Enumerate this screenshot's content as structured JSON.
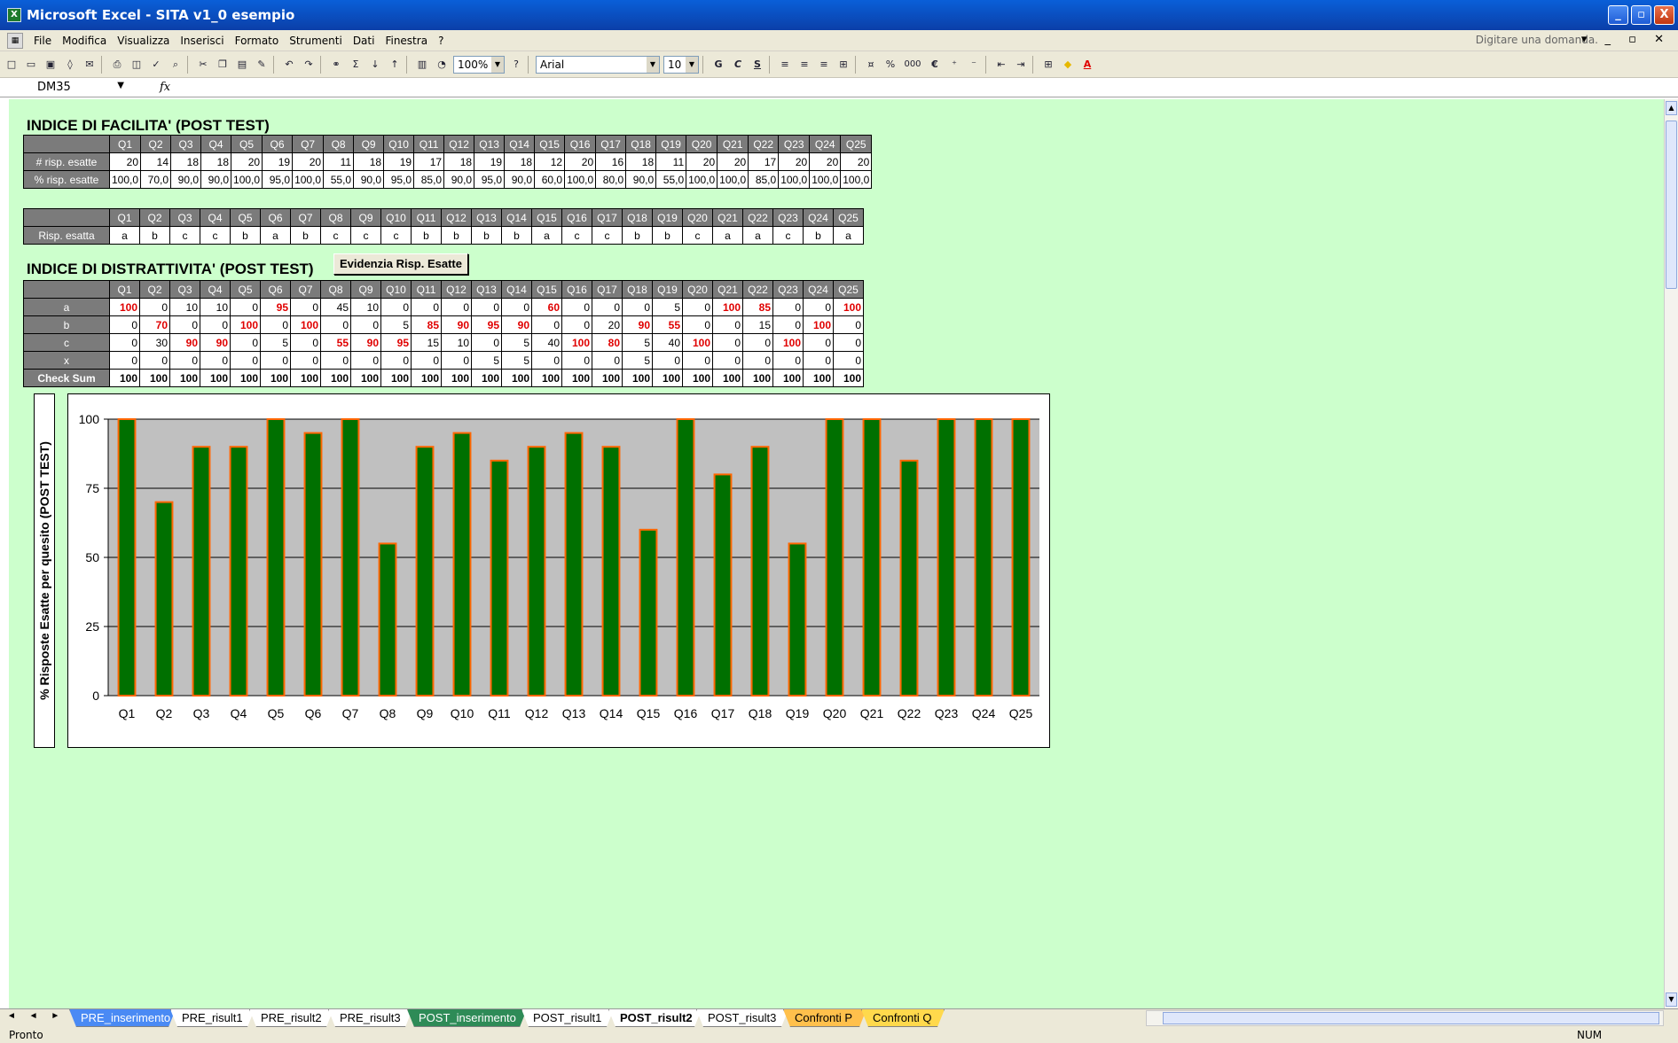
{
  "window": {
    "title": "Microsoft Excel - SITA v1_0 esempio",
    "min": "_",
    "max": "▫",
    "close": "X"
  },
  "menu": {
    "items": [
      "File",
      "Modifica",
      "Visualizza",
      "Inserisci",
      "Formato",
      "Strumenti",
      "Dati",
      "Finestra",
      "?"
    ],
    "ask_placeholder": "Digitare una domanda.",
    "mdi_controls": "▾ _ ▫ ✕"
  },
  "toolbar": {
    "zoom": "100%",
    "font": "Arial",
    "font_size": "10",
    "bold": "G",
    "italic": "C",
    "underline": "S",
    "percent": "%",
    "thousands": "000",
    "currency": "€"
  },
  "formula_bar": {
    "cell_ref": "DM35",
    "fx": "fx"
  },
  "questions": [
    "Q1",
    "Q2",
    "Q3",
    "Q4",
    "Q5",
    "Q6",
    "Q7",
    "Q8",
    "Q9",
    "Q10",
    "Q11",
    "Q12",
    "Q13",
    "Q14",
    "Q15",
    "Q16",
    "Q17",
    "Q18",
    "Q19",
    "Q20",
    "Q21",
    "Q22",
    "Q23",
    "Q24",
    "Q25"
  ],
  "facility": {
    "title": "INDICE DI FACILITA' (POST TEST)",
    "row_correct_label": "# risp. esatte",
    "row_pct_label": "% risp. esatte",
    "correct": [
      "20",
      "14",
      "18",
      "18",
      "20",
      "19",
      "20",
      "11",
      "18",
      "19",
      "17",
      "18",
      "19",
      "18",
      "12",
      "20",
      "16",
      "18",
      "11",
      "20",
      "20",
      "17",
      "20",
      "20",
      "20"
    ],
    "pct": [
      "100,0",
      "70,0",
      "90,0",
      "90,0",
      "100,0",
      "95,0",
      "100,0",
      "55,0",
      "90,0",
      "95,0",
      "85,0",
      "90,0",
      "95,0",
      "90,0",
      "60,0",
      "100,0",
      "80,0",
      "90,0",
      "55,0",
      "100,0",
      "100,0",
      "85,0",
      "100,0",
      "100,0",
      "100,0"
    ]
  },
  "answers": {
    "row_label": "Risp. esatta",
    "values": [
      "a",
      "b",
      "c",
      "c",
      "b",
      "a",
      "b",
      "c",
      "c",
      "c",
      "b",
      "b",
      "b",
      "b",
      "a",
      "c",
      "c",
      "b",
      "b",
      "c",
      "a",
      "a",
      "c",
      "b",
      "a"
    ]
  },
  "distract": {
    "title": "INDICE DI DISTRATTIVITA' (POST TEST)",
    "button_label": "Evidenzia Risp. Esatte",
    "checksum_label": "Check Sum",
    "rows": [
      {
        "label": "a",
        "values": [
          "100",
          "0",
          "10",
          "10",
          "0",
          "95",
          "0",
          "45",
          "10",
          "0",
          "0",
          "0",
          "0",
          "0",
          "60",
          "0",
          "0",
          "0",
          "5",
          "0",
          "100",
          "85",
          "0",
          "0",
          "100"
        ]
      },
      {
        "label": "b",
        "values": [
          "0",
          "70",
          "0",
          "0",
          "100",
          "0",
          "100",
          "0",
          "0",
          "5",
          "85",
          "90",
          "95",
          "90",
          "0",
          "0",
          "20",
          "90",
          "55",
          "0",
          "0",
          "15",
          "0",
          "100",
          "0"
        ]
      },
      {
        "label": "c",
        "values": [
          "0",
          "30",
          "90",
          "90",
          "0",
          "5",
          "0",
          "55",
          "90",
          "95",
          "15",
          "10",
          "0",
          "5",
          "40",
          "100",
          "80",
          "5",
          "40",
          "100",
          "0",
          "0",
          "100",
          "0",
          "0"
        ]
      },
      {
        "label": "x",
        "values": [
          "0",
          "0",
          "0",
          "0",
          "0",
          "0",
          "0",
          "0",
          "0",
          "0",
          "0",
          "0",
          "5",
          "5",
          "0",
          "0",
          "0",
          "5",
          "0",
          "0",
          "0",
          "0",
          "0",
          "0",
          "0"
        ]
      }
    ],
    "checksum": [
      "100",
      "100",
      "100",
      "100",
      "100",
      "100",
      "100",
      "100",
      "100",
      "100",
      "100",
      "100",
      "100",
      "100",
      "100",
      "100",
      "100",
      "100",
      "100",
      "100",
      "100",
      "100",
      "100",
      "100",
      "100"
    ]
  },
  "chart_data": {
    "type": "bar",
    "categories": [
      "Q1",
      "Q2",
      "Q3",
      "Q4",
      "Q5",
      "Q6",
      "Q7",
      "Q8",
      "Q9",
      "Q10",
      "Q11",
      "Q12",
      "Q13",
      "Q14",
      "Q15",
      "Q16",
      "Q17",
      "Q18",
      "Q19",
      "Q20",
      "Q21",
      "Q22",
      "Q23",
      "Q24",
      "Q25"
    ],
    "values": [
      100,
      70,
      90,
      90,
      100,
      95,
      100,
      55,
      90,
      95,
      85,
      90,
      95,
      90,
      60,
      100,
      80,
      90,
      55,
      100,
      100,
      85,
      100,
      100,
      100
    ],
    "ylabel": "% Risposte Esatte per quesito (POST  TEST)",
    "ylim": [
      0,
      100
    ],
    "yticks": [
      "0",
      "25",
      "50",
      "75",
      "100"
    ],
    "bar_color": "#007000",
    "bar_border": "#ff6600",
    "plot_bg": "#c0c0c0",
    "grid": true
  },
  "tabs": {
    "nav": "◄ ◄ ► ►",
    "items": [
      {
        "label": "PRE_inserimento",
        "bg": "#4a8af4",
        "fg": "#ffffff"
      },
      {
        "label": "PRE_risult1",
        "bg": "#ffffff",
        "fg": "#000000"
      },
      {
        "label": "PRE_risult2",
        "bg": "#ffffff",
        "fg": "#000000"
      },
      {
        "label": "PRE_risult3",
        "bg": "#ffffff",
        "fg": "#000000"
      },
      {
        "label": "POST_inserimento",
        "bg": "#2e8b57",
        "fg": "#ffffff"
      },
      {
        "label": "POST_risult1",
        "bg": "#ffffff",
        "fg": "#000000"
      },
      {
        "label": "POST_risult2",
        "bg": "#ffffff",
        "fg": "#000000",
        "active": true
      },
      {
        "label": "POST_risult3",
        "bg": "#ffffff",
        "fg": "#000000"
      },
      {
        "label": "Confronti P",
        "bg": "#ffc04c",
        "fg": "#000000"
      },
      {
        "label": "Confronti Q",
        "bg": "#ffd94c",
        "fg": "#000000"
      }
    ]
  },
  "status": {
    "left": "Pronto",
    "right": "NUM"
  }
}
